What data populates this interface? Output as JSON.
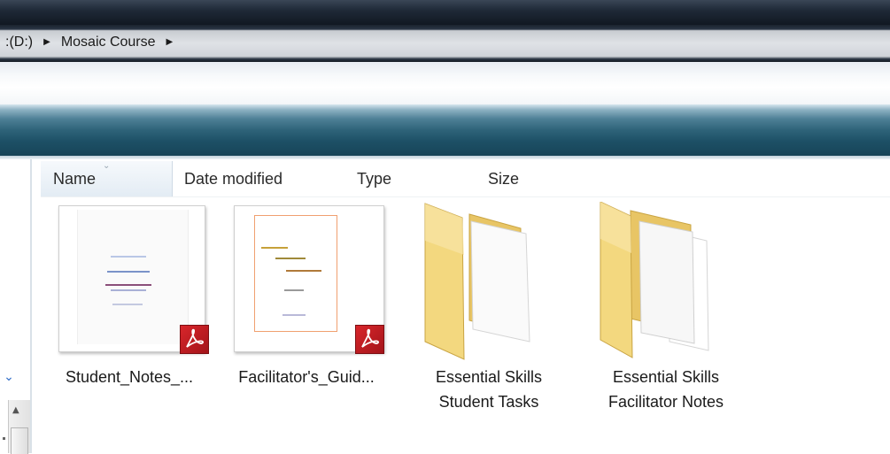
{
  "window": {
    "breadcrumbs": [
      ":(D:)",
      "Mosaic Course"
    ]
  },
  "columns": {
    "name": "Name",
    "date_modified": "Date modified",
    "type": "Type",
    "size": "Size"
  },
  "items": [
    {
      "label": "Student_Notes_...",
      "kind": "pdf",
      "icon": "pdf-document-icon"
    },
    {
      "label": "Facilitator's_Guid...",
      "kind": "pdf",
      "icon": "pdf-document-icon"
    },
    {
      "label_line1": "Essential Skills",
      "label_line2": "Student Tasks",
      "kind": "folder",
      "icon": "folder-icon"
    },
    {
      "label_line1": "Essential Skills",
      "label_line2": "Facilitator Notes",
      "kind": "folder",
      "icon": "folder-icon"
    }
  ],
  "colors": {
    "toolbar": "#2e6379",
    "pdf_badge": "#c41e25",
    "folder": "#f2d27a"
  }
}
